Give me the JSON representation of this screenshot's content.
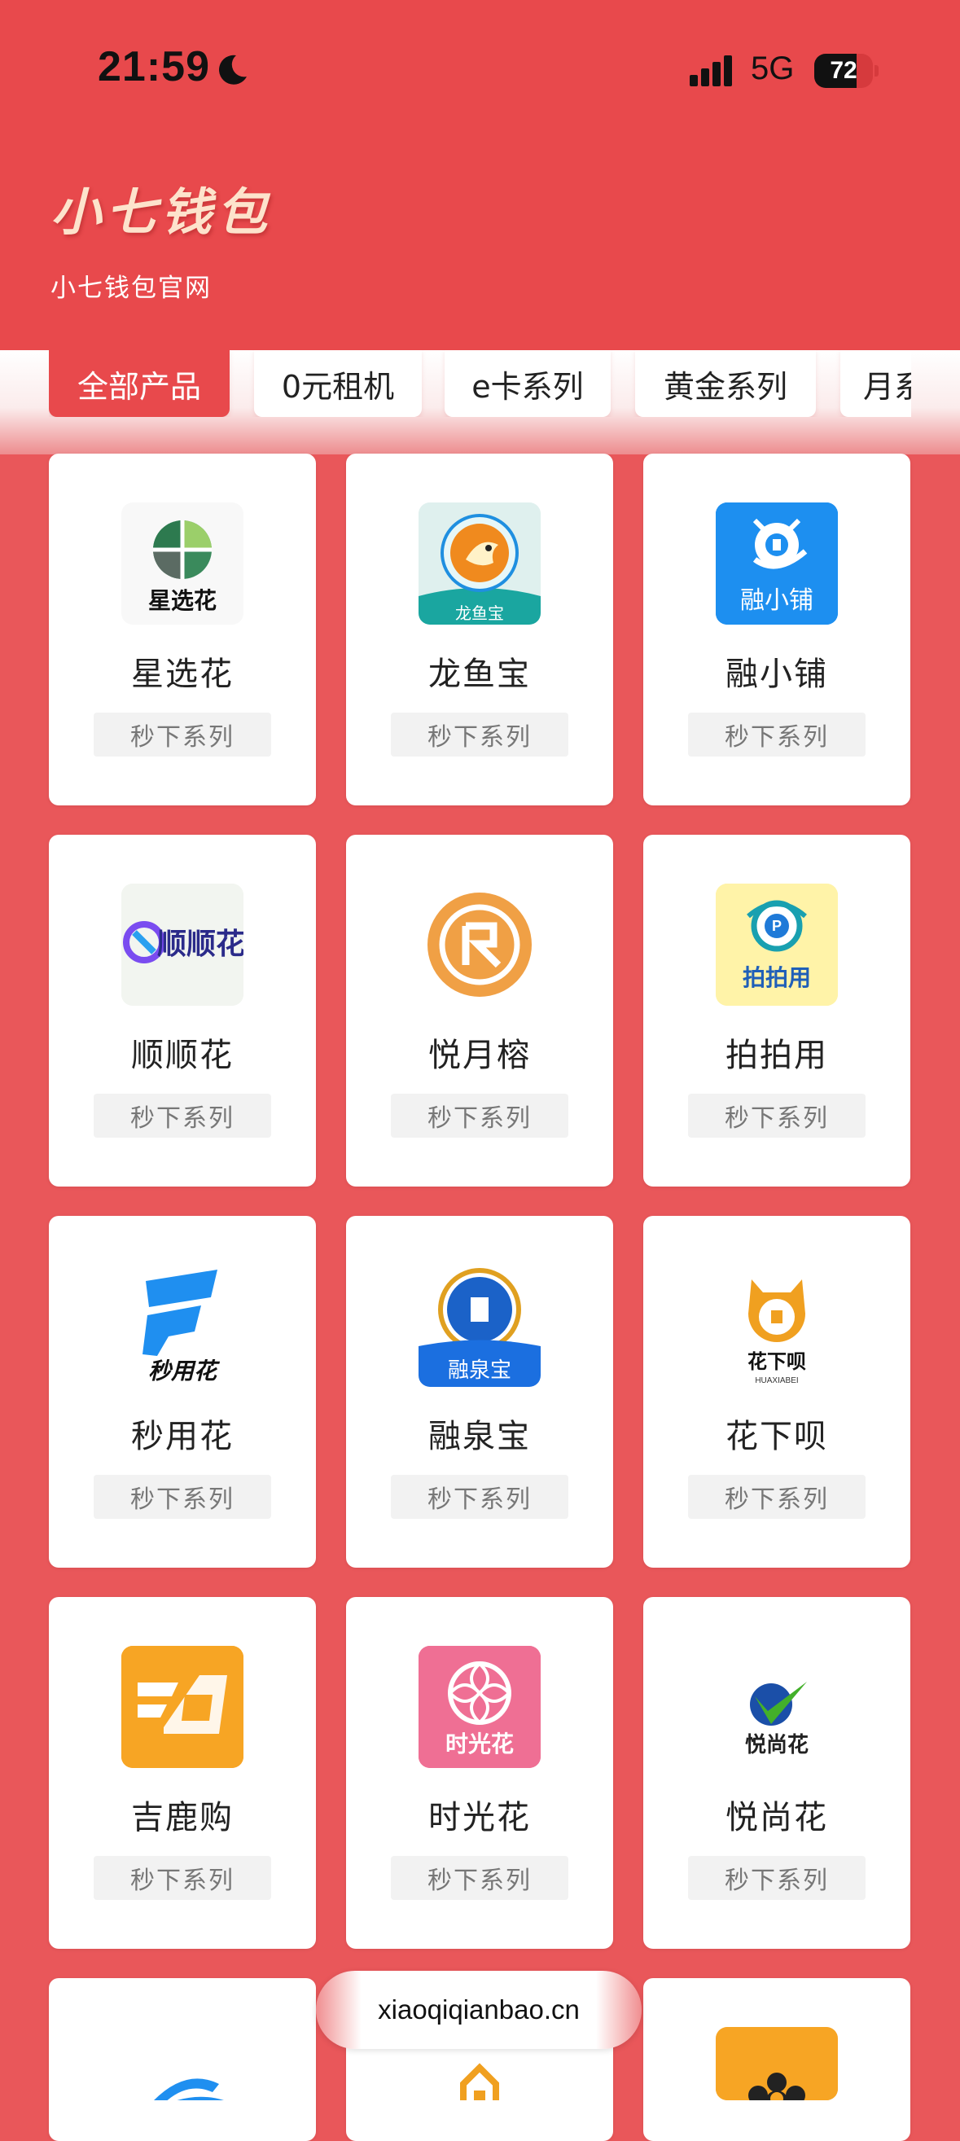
{
  "status_bar": {
    "time": "21:59",
    "network": "5G",
    "battery": "72",
    "battery_level": 0.72,
    "icons": [
      "moon-icon",
      "signal-icon",
      "battery-icon"
    ]
  },
  "header": {
    "title": "小七钱包",
    "subtitle": "小七钱包官网"
  },
  "colors": {
    "brand_red": "#e8494c",
    "background": "#e9575a",
    "title_cream": "#fde3cc"
  },
  "tabs": [
    {
      "label": "全部产品",
      "active": true
    },
    {
      "label": "0元租机",
      "active": false
    },
    {
      "label": "e卡系列",
      "active": false
    },
    {
      "label": "黄金系列",
      "active": false
    },
    {
      "label": "月系",
      "active": false
    }
  ],
  "products": [
    {
      "name": "星选花",
      "tag": "秒下系列",
      "logo_text": "星选花",
      "icon": "xingxuanhua-logo-icon"
    },
    {
      "name": "龙鱼宝",
      "tag": "秒下系列",
      "logo_text": "龙鱼宝",
      "icon": "longyubao-logo-icon"
    },
    {
      "name": "融小铺",
      "tag": "秒下系列",
      "logo_text": "融小铺",
      "icon": "rongxiaopu-logo-icon"
    },
    {
      "name": "顺顺花",
      "tag": "秒下系列",
      "logo_text": "顺顺花",
      "icon": "shunshunhua-logo-icon"
    },
    {
      "name": "悦月榕",
      "tag": "秒下系列",
      "logo_text": "",
      "icon": "yueyuerong-logo-icon"
    },
    {
      "name": "拍拍用",
      "tag": "秒下系列",
      "logo_text": "拍拍用",
      "icon": "paipaiyong-logo-icon"
    },
    {
      "name": "秒用花",
      "tag": "秒下系列",
      "logo_text": "秒用花",
      "icon": "miaoyonghua-logo-icon"
    },
    {
      "name": "融泉宝",
      "tag": "秒下系列",
      "logo_text": "融泉宝",
      "icon": "rongquanbao-logo-icon"
    },
    {
      "name": "花下呗",
      "tag": "秒下系列",
      "logo_text": "花下呗",
      "logo_subtext": "HUAXIABEI",
      "icon": "huaxiabei-logo-icon"
    },
    {
      "name": "吉鹿购",
      "tag": "秒下系列",
      "logo_text": "",
      "icon": "jilugou-logo-icon"
    },
    {
      "name": "时光花",
      "tag": "秒下系列",
      "logo_text": "时光花",
      "icon": "shiguanghua-logo-icon"
    },
    {
      "name": "悦尚花",
      "tag": "秒下系列",
      "logo_text": "悦尚花",
      "icon": "yueshanghua-logo-icon"
    },
    {
      "name": "",
      "tag": "",
      "logo_text": "",
      "icon": "partial-blue-logo-icon"
    },
    {
      "name": "",
      "tag": "",
      "logo_text": "",
      "icon": "partial-orange-logo-icon"
    },
    {
      "name": "",
      "tag": "",
      "logo_text": "",
      "icon": "partial-flower-logo-icon"
    }
  ],
  "footer": {
    "url": "xiaoqiqianbao.cn"
  }
}
